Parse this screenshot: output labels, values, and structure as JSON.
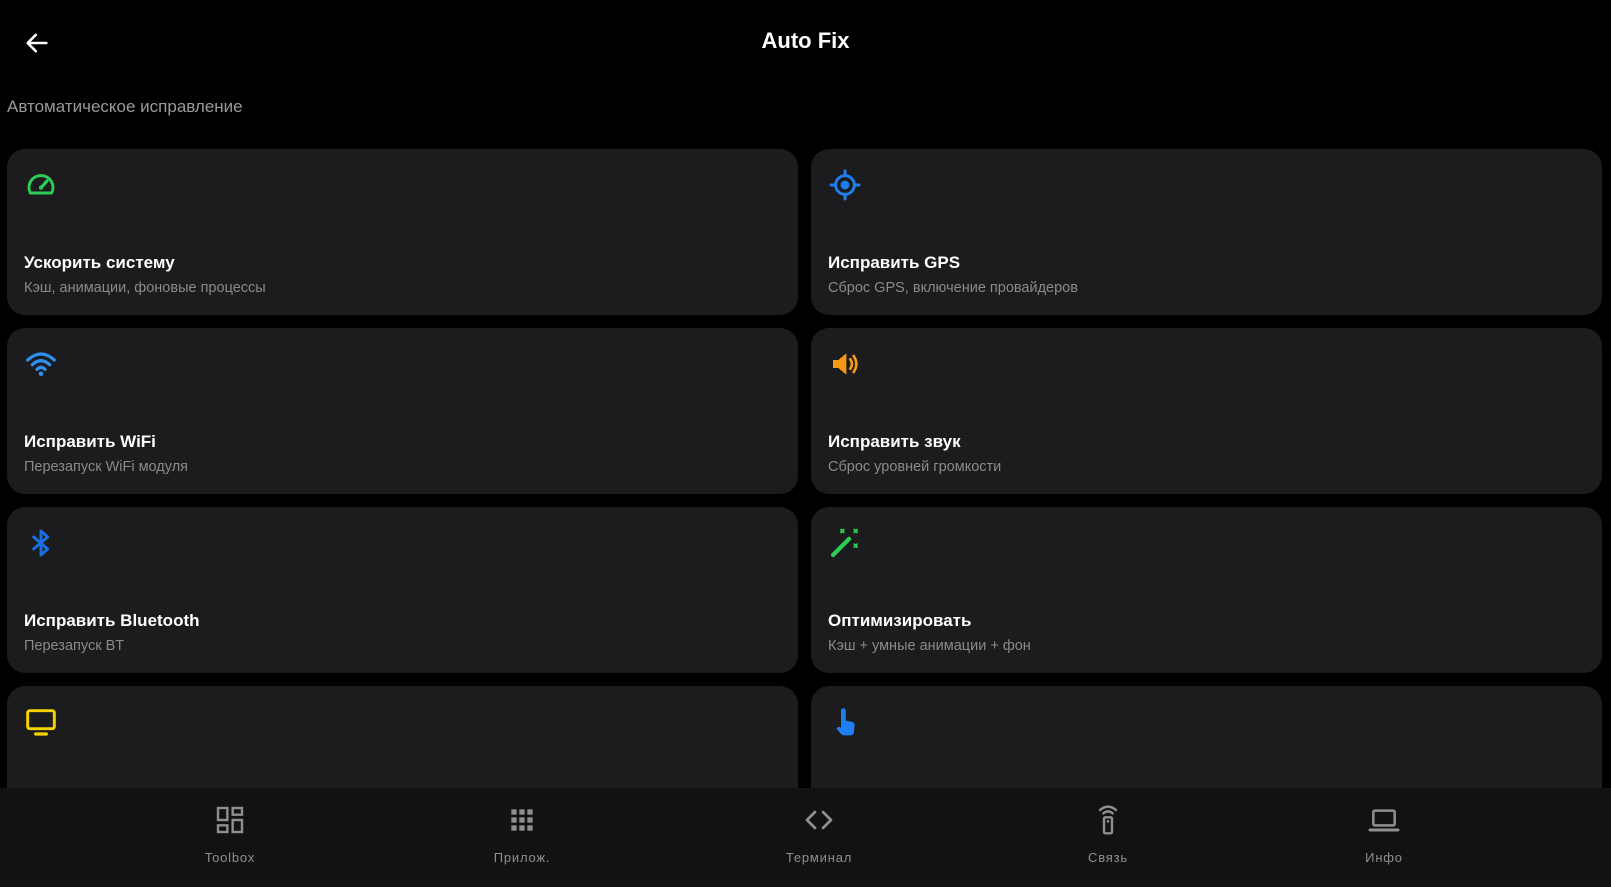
{
  "header": {
    "title": "Auto Fix",
    "back_icon": "arrow-left-icon"
  },
  "section": {
    "label": "Автоматическое исправление"
  },
  "cards": [
    {
      "title": "Ускорить систему",
      "subtitle": "Кэш, анимации, фоновые процессы",
      "icon": "speedometer-icon",
      "color": "#2ecc55"
    },
    {
      "title": "Исправить GPS",
      "subtitle": "Сброс GPS, включение провайдеров",
      "icon": "gps-target-icon",
      "color": "#1e7ff0"
    },
    {
      "title": "Исправить WiFi",
      "subtitle": "Перезапуск WiFi модуля",
      "icon": "wifi-icon",
      "color": "#2f8ff2"
    },
    {
      "title": "Исправить звук",
      "subtitle": "Сброс уровней громкости",
      "icon": "volume-icon",
      "color": "#f59a14"
    },
    {
      "title": "Исправить Bluetooth",
      "subtitle": "Перезапуск BT",
      "icon": "bluetooth-icon",
      "color": "#1a6fe0"
    },
    {
      "title": "Оптимизировать",
      "subtitle": "Кэш + умные анимации + фон",
      "icon": "magic-wand-icon",
      "color": "#2ecc55"
    },
    {
      "title": "",
      "subtitle": "",
      "icon": "monitor-icon",
      "color": "#f5d300"
    },
    {
      "title": "",
      "subtitle": "",
      "icon": "touch-hand-icon",
      "color": "#1e7ff0"
    }
  ],
  "bottom_nav": [
    {
      "label": "Toolbox",
      "icon": "dashboard-grid-icon"
    },
    {
      "label": "Прилож.",
      "icon": "apps-grid-icon"
    },
    {
      "label": "Терминал",
      "icon": "code-brackets-icon"
    },
    {
      "label": "Связь",
      "icon": "remote-signal-icon"
    },
    {
      "label": "Инфо",
      "icon": "laptop-icon"
    }
  ],
  "colors": {
    "background": "#000000",
    "card": "#1c1c1e",
    "nav_background": "#121212",
    "muted_text": "#8a8a8a"
  }
}
